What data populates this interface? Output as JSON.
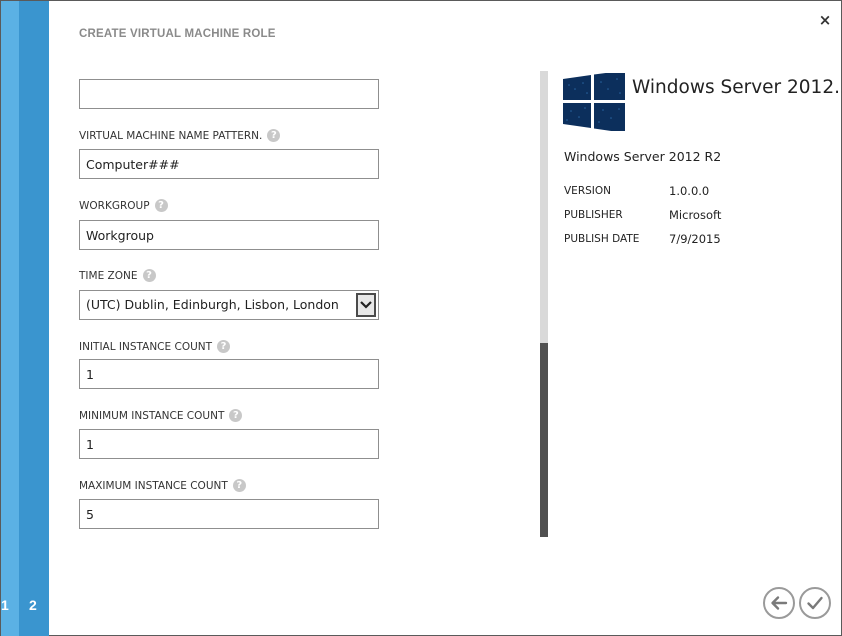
{
  "dialog": {
    "title": "CREATE VIRTUAL MACHINE ROLE",
    "close_glyph": "×"
  },
  "steps": [
    "1",
    "2"
  ],
  "form": {
    "top_field": {
      "value": ""
    },
    "vm_name_pattern": {
      "label": "VIRTUAL MACHINE NAME PATTERN.",
      "value": "Computer###"
    },
    "workgroup": {
      "label": "WORKGROUP",
      "value": "Workgroup"
    },
    "time_zone": {
      "label": "TIME ZONE",
      "value": "(UTC) Dublin, Edinburgh, Lisbon, London"
    },
    "initial_instance_count": {
      "label": "INITIAL INSTANCE COUNT",
      "value": "1"
    },
    "minimum_instance_count": {
      "label": "MINIMUM INSTANCE COUNT",
      "value": "1"
    },
    "maximum_instance_count": {
      "label": "MAXIMUM INSTANCE COUNT",
      "value": "5"
    },
    "help_glyph": "?"
  },
  "gallery_item": {
    "name": "Windows Server 2012...",
    "subtitle": "Windows Server 2012 R2",
    "logo_icon": "windows-logo-icon",
    "details": [
      {
        "key": "VERSION",
        "value": "1.0.0.0"
      },
      {
        "key": "PUBLISHER",
        "value": "Microsoft"
      },
      {
        "key": "PUBLISH DATE",
        "value": "7/9/2015"
      }
    ]
  },
  "navigation": {
    "back_icon": "arrow-left-icon",
    "done_icon": "checkmark-icon"
  },
  "colors": {
    "rail_light": "#5bb1e4",
    "rail_dark": "#3a95cf",
    "logo_blue": "#0c2f5c"
  }
}
